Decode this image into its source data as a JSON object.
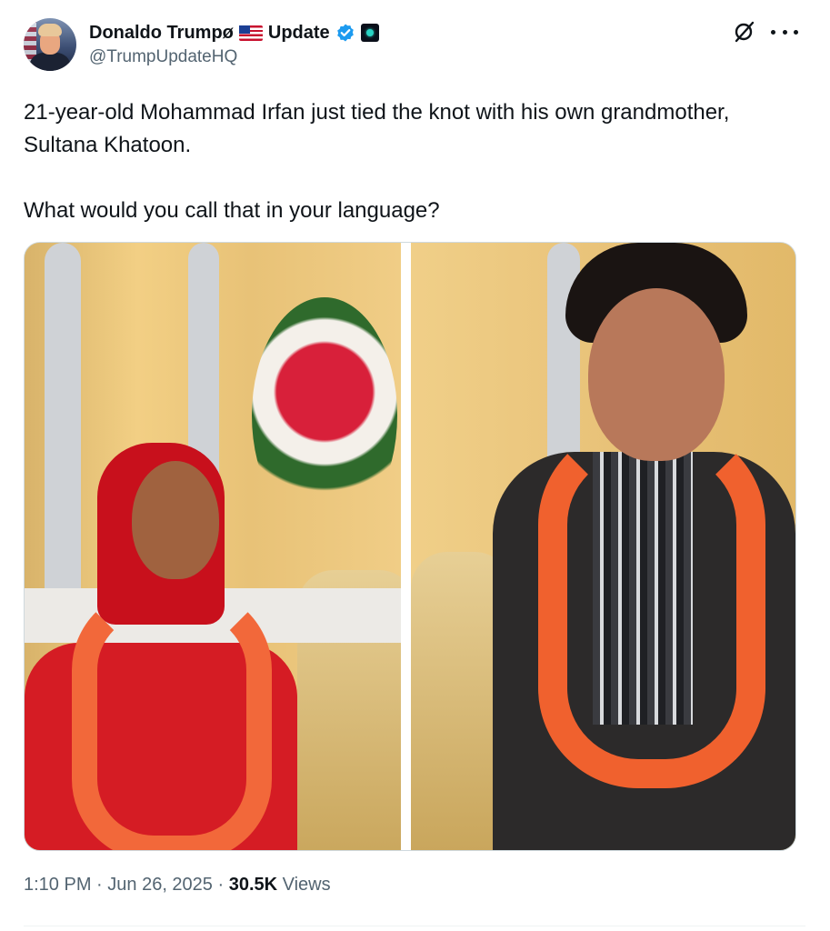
{
  "author": {
    "name": "Donaldo Trumpø",
    "suffix": "Update",
    "handle": "@TrumpUpdateHQ",
    "flag_icon": "us-flag-icon",
    "verified_icon": "verified-badge-icon",
    "affiliate_icon": "affiliate-badge-icon"
  },
  "actions": {
    "grok_icon": "grok-icon",
    "more_icon": "more-options-icon"
  },
  "tweet": {
    "line1": "21-year-old Mohammad Irfan just tied the knot with his own grandmother, Sultana Khatoon.",
    "line2": "What would you call that in your language?"
  },
  "media": {
    "left_photo": "woman-in-red-with-garland",
    "right_photo": "young-man-with-garland"
  },
  "meta": {
    "time": "1:10 PM",
    "separator1": " · ",
    "date": "Jun 26, 2025",
    "separator2": " · ",
    "views_count": "30.5K",
    "views_label": " Views"
  },
  "colors": {
    "text_primary": "#0f1419",
    "text_secondary": "#536471",
    "verified_blue": "#1d9bf0",
    "border": "#cfd9de"
  }
}
